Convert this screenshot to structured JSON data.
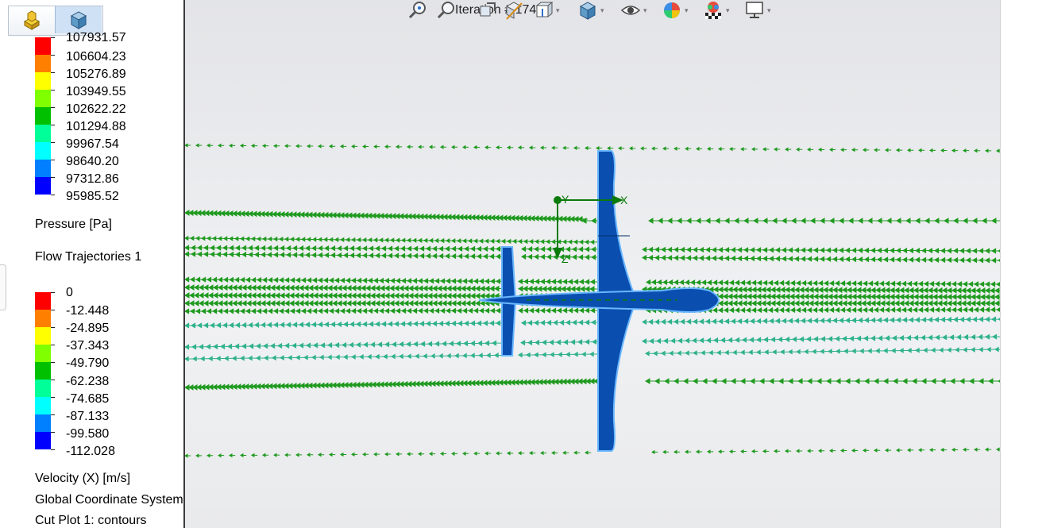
{
  "pressure_legend": {
    "colors": [
      "#ff0000",
      "#ff7f00",
      "#ffff00",
      "#80ff00",
      "#00c000",
      "#00ff99",
      "#00ffff",
      "#0080ff",
      "#0000ff"
    ],
    "labels": [
      "107931.57",
      "106604.23",
      "105276.89",
      "103949.55",
      "102622.22",
      "101294.88",
      "99967.54",
      "98640.20",
      "97312.86",
      "95985.52"
    ],
    "title": "Pressure [Pa]"
  },
  "trajectories_title": "Flow Trajectories 1",
  "velocity_legend": {
    "colors": [
      "#ff0000",
      "#ff7f00",
      "#ffff00",
      "#80ff00",
      "#00c000",
      "#00ff99",
      "#00ffff",
      "#0080ff",
      "#0000ff"
    ],
    "labels": [
      "0",
      "-12.448",
      "-24.895",
      "-37.343",
      "-49.790",
      "-62.238",
      "-74.685",
      "-87.133",
      "-99.580",
      "-112.028"
    ],
    "title": "Velocity (X) [m/s]"
  },
  "coord_system": "Global Coordinate System",
  "cut_plot": "Cut Plot 1: contours",
  "iteration": "Iteration #  174",
  "axes": {
    "x": "X",
    "y": "Y",
    "z": "Z"
  },
  "toolbar": {
    "icons": [
      "zoom-to-fit-icon",
      "zoom-area-icon",
      "previous-view-icon",
      "section-view-icon",
      "view-orientation-icon",
      "display-style-icon",
      "hide-show-items-icon",
      "edit-appearance-icon",
      "apply-scene-icon",
      "view-settings-icon"
    ]
  },
  "theme": {
    "streamline_green": "#1f9a1f",
    "streamline_teal": "#2fb28a",
    "aircraft_blue": "#0a4fb0",
    "axis_green": "#0a7a0a"
  }
}
